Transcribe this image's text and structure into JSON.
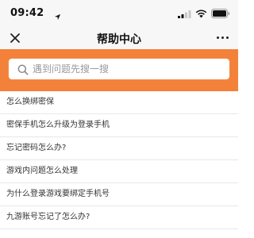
{
  "status_bar": {
    "time": "09:42"
  },
  "nav": {
    "title": "帮助中心",
    "close_icon": "close-icon",
    "more_icon": "more-icon"
  },
  "search": {
    "placeholder": "遇到问题先搜一搜",
    "value": "",
    "band_color": "#f4813a"
  },
  "faq": {
    "items": [
      "怎么换绑密保",
      "密保手机怎么升级为登录手机",
      "忘记密码怎么办?",
      "游戏内问题怎么处理",
      "为什么登录游戏要绑定手机号",
      "九游账号忘记了怎么办?"
    ]
  }
}
